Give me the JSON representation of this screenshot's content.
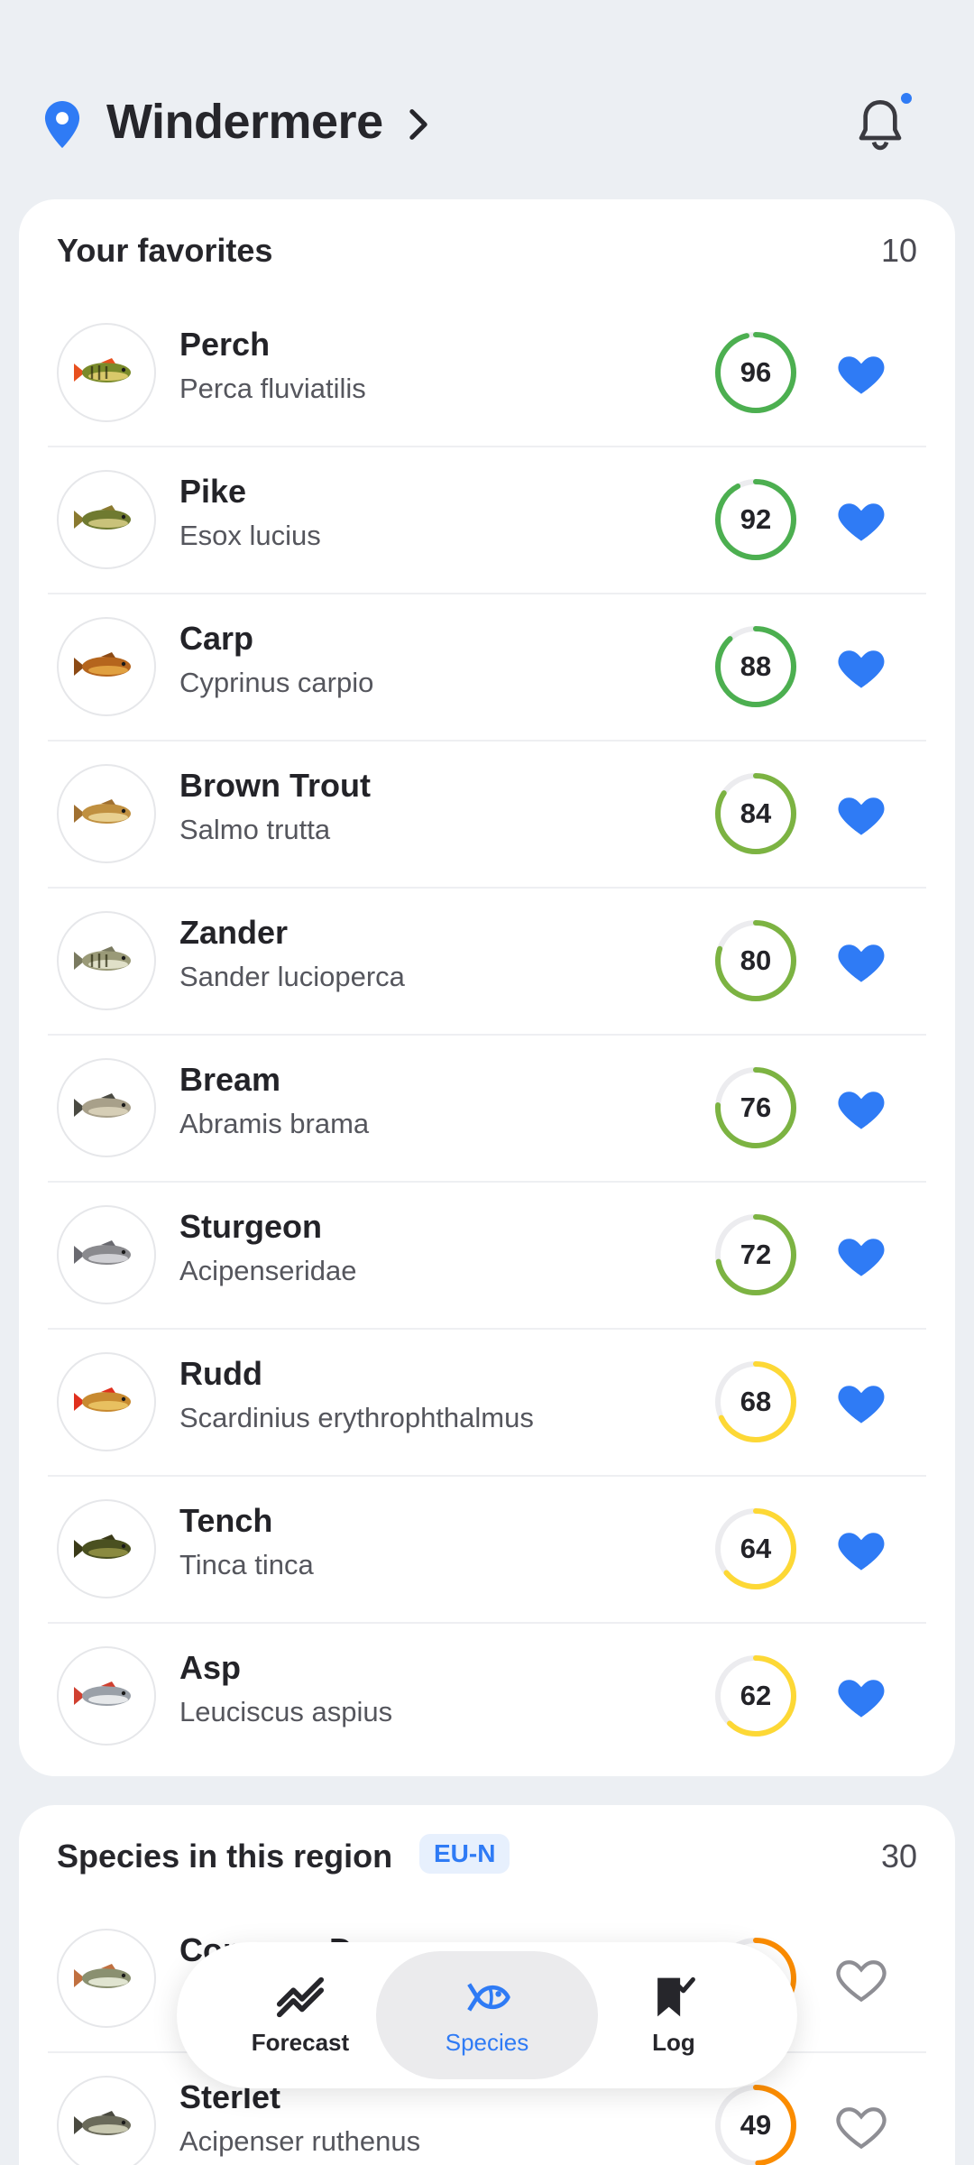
{
  "header": {
    "location": "Windermere"
  },
  "colors": {
    "accent": "#2f7bf5",
    "score_green": "#4caf50",
    "score_lime": "#7cb342",
    "score_yellow": "#fdd835",
    "score_orange": "#fb8c00"
  },
  "favorites": {
    "title": "Your favorites",
    "count": "10",
    "items": [
      {
        "name": "Perch",
        "scientific": "Perca fluviatilis",
        "score": "96",
        "favorite": true
      },
      {
        "name": "Pike",
        "scientific": "Esox lucius",
        "score": "92",
        "favorite": true
      },
      {
        "name": "Carp",
        "scientific": "Cyprinus carpio",
        "score": "88",
        "favorite": true
      },
      {
        "name": "Brown Trout",
        "scientific": "Salmo trutta",
        "score": "84",
        "favorite": true
      },
      {
        "name": "Zander",
        "scientific": "Sander lucioperca",
        "score": "80",
        "favorite": true
      },
      {
        "name": "Bream",
        "scientific": "Abramis brama",
        "score": "76",
        "favorite": true
      },
      {
        "name": "Sturgeon",
        "scientific": "Acipenseridae",
        "score": "72",
        "favorite": true
      },
      {
        "name": "Rudd",
        "scientific": "Scardinius erythrophthalmus",
        "score": "68",
        "favorite": true
      },
      {
        "name": "Tench",
        "scientific": "Tinca tinca",
        "score": "64",
        "favorite": true
      },
      {
        "name": "Asp",
        "scientific": "Leuciscus aspius",
        "score": "62",
        "favorite": true
      }
    ]
  },
  "region": {
    "title": "Species in this region",
    "badge": "EU-N",
    "count": "30",
    "items": [
      {
        "name": "Common Dace",
        "scientific": "",
        "score": "",
        "favorite": false
      },
      {
        "name": "Sterlet",
        "scientific": "Acipenser ruthenus",
        "score": "49",
        "favorite": false
      }
    ]
  },
  "nav": {
    "forecast": "Forecast",
    "species": "Species",
    "log": "Log"
  }
}
